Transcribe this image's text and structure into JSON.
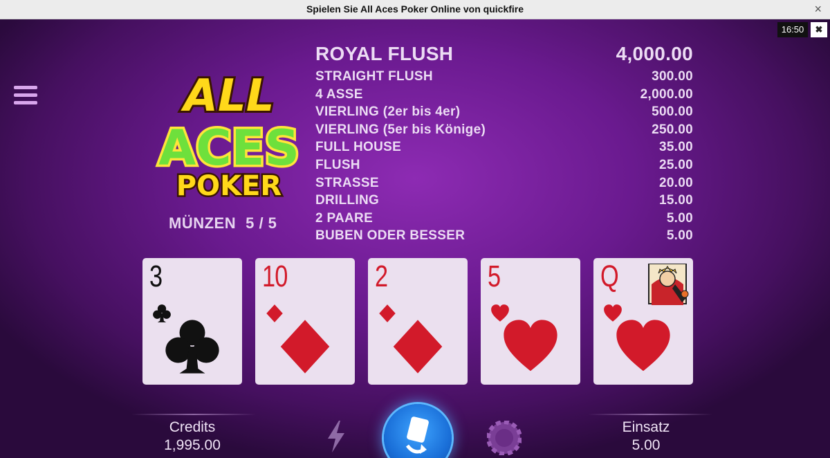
{
  "window": {
    "title": "Spielen Sie All Aces Poker Online von quickfire",
    "close_icon": "close-icon"
  },
  "status": {
    "clock": "16:50",
    "close_glyph": "✖"
  },
  "logo": {
    "line1": "ALL",
    "line2": "ACES",
    "line3": "POKER"
  },
  "coins": {
    "label": "MÜNZEN",
    "value": "5 / 5"
  },
  "paytable": [
    {
      "hand": "ROYAL FLUSH",
      "payout": "4,000.00"
    },
    {
      "hand": "STRAIGHT FLUSH",
      "payout": "300.00"
    },
    {
      "hand": "4 ASSE",
      "payout": "2,000.00"
    },
    {
      "hand": "VIERLING (2er bis 4er)",
      "payout": "500.00"
    },
    {
      "hand": "VIERLING (5er bis Könige)",
      "payout": "250.00"
    },
    {
      "hand": "FULL HOUSE",
      "payout": "35.00"
    },
    {
      "hand": "FLUSH",
      "payout": "25.00"
    },
    {
      "hand": "STRASSE",
      "payout": "20.00"
    },
    {
      "hand": "DRILLING",
      "payout": "15.00"
    },
    {
      "hand": "2 PAARE",
      "payout": "5.00"
    },
    {
      "hand": "BUBEN ODER BESSER",
      "payout": "5.00"
    }
  ],
  "cards": [
    {
      "rank": "3",
      "suit": "clubs",
      "color": "black"
    },
    {
      "rank": "10",
      "suit": "diamonds",
      "color": "red"
    },
    {
      "rank": "2",
      "suit": "diamonds",
      "color": "red"
    },
    {
      "rank": "5",
      "suit": "hearts",
      "color": "red"
    },
    {
      "rank": "Q",
      "suit": "hearts",
      "color": "red"
    }
  ],
  "footer": {
    "credits_label": "Credits",
    "credits_value": "1,995.00",
    "bet_label": "Einsatz",
    "bet_value": "5.00"
  },
  "colors": {
    "background": "#6a1a8f",
    "card_red": "#d21a2a",
    "deal_button": "#1a6fd8",
    "logo_yellow": "#ffd81a",
    "logo_green": "#6ee03c"
  },
  "icons": {
    "menu": "hamburger-menu-icon",
    "turbo": "lightning-bolt-icon",
    "deal": "deal-cards-icon",
    "bet": "chip-icon"
  }
}
